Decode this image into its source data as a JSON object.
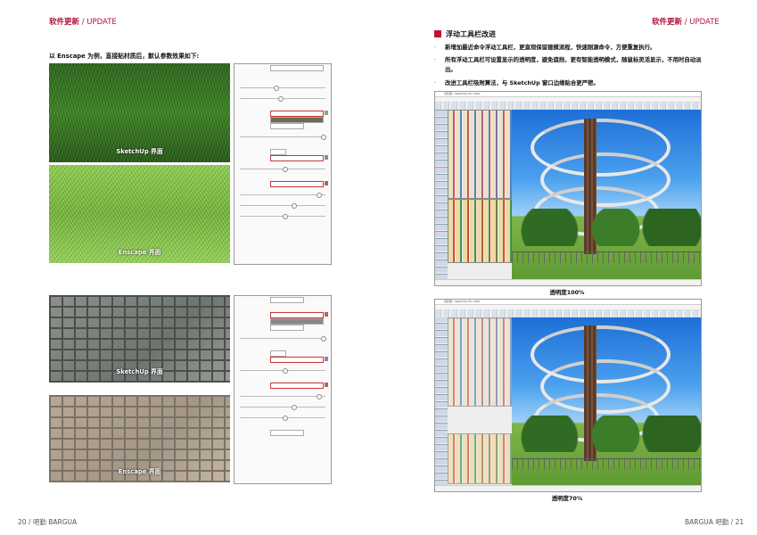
{
  "left_page": {
    "header": {
      "cn": "软件更新",
      "sep": " / ",
      "en": "UPDATE"
    },
    "intro": "以 Enscape 为例，直接贴材质后，默认参数效果如下:",
    "textures": [
      {
        "caption": "SketchUp 界面"
      },
      {
        "caption": "Enscape 界面"
      },
      {
        "caption": "SketchUp 界面"
      },
      {
        "caption": "Enscape 界面"
      }
    ],
    "footer": "20 / 吧勤 BARGUA"
  },
  "right_page": {
    "header": {
      "cn": "软件更新",
      "sep": " / ",
      "en": "UPDATE"
    },
    "section_title": "浮动工具栏改进",
    "bullets": [
      "新增加最近命令浮动工具栏，更直观保留建模流程，快速刚源命令，方便重复执行。",
      "所有浮动工具栏可设置显示的透明度，避免遮挡，更有智能透明模式，随鼠标灵活显示，不用时自动淡出。",
      "改进工具栏吸附算法，与 SketchUp 窗口边缘贴合更严密。"
    ],
    "screenshots": [
      {
        "title": "无标题 - SketchUp Pro 2022",
        "caption": "透明度100%"
      },
      {
        "title": "无标题 - SketchUp Pro 2022",
        "caption": "透明度70%"
      }
    ],
    "footer": "BARGUA 吧勤 / 21"
  }
}
